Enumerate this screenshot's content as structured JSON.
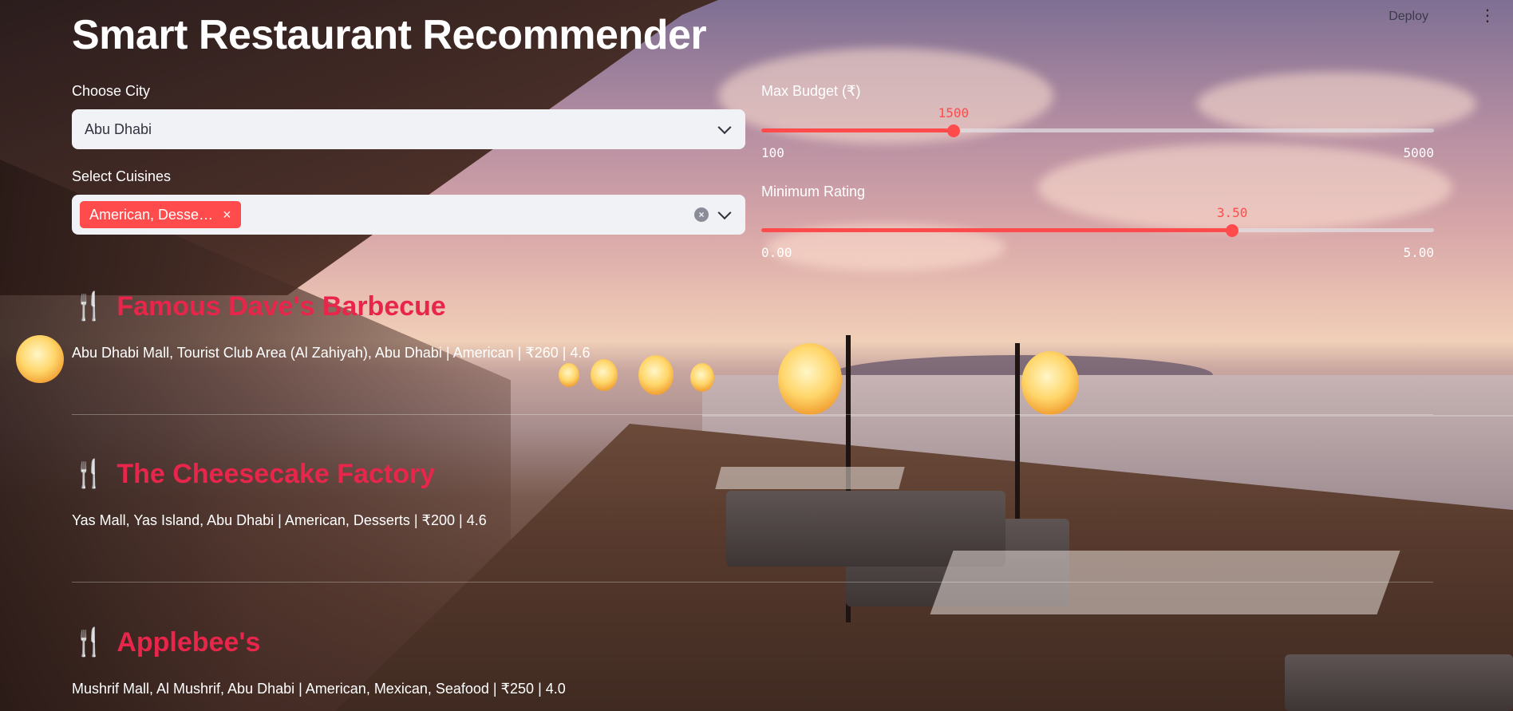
{
  "app": {
    "title": "Smart Restaurant Recommender",
    "deploy_label": "Deploy",
    "menu_icon": "more-vertical-icon",
    "accent_color": "#ff4b4b",
    "restaurant_color": "#e8254a"
  },
  "filters": {
    "city": {
      "label": "Choose City",
      "value": "Abu Dhabi"
    },
    "cuisines": {
      "label": "Select Cuisines",
      "selected_tag": "American, Desse…"
    },
    "budget": {
      "label": "Max Budget (₹)",
      "value": "1500",
      "min": "100",
      "max": "5000",
      "fraction": 0.2857
    },
    "rating": {
      "label": "Minimum Rating",
      "value": "3.50",
      "min": "0.00",
      "max": "5.00",
      "fraction": 0.7
    }
  },
  "results": [
    {
      "icon": "🍴",
      "name": "Famous Dave's Barbecue",
      "info": "Abu Dhabi Mall, Tourist Club Area (Al Zahiyah), Abu Dhabi | American | ₹260 | 4.6"
    },
    {
      "icon": "🍴",
      "name": "The Cheesecake Factory",
      "info": "Yas Mall, Yas Island, Abu Dhabi | American, Desserts | ₹200 | 4.6"
    },
    {
      "icon": "🍴",
      "name": "Applebee's",
      "info": "Mushrif Mall, Al Mushrif, Abu Dhabi | American, Mexican, Seafood | ₹250 | 4.0"
    }
  ]
}
